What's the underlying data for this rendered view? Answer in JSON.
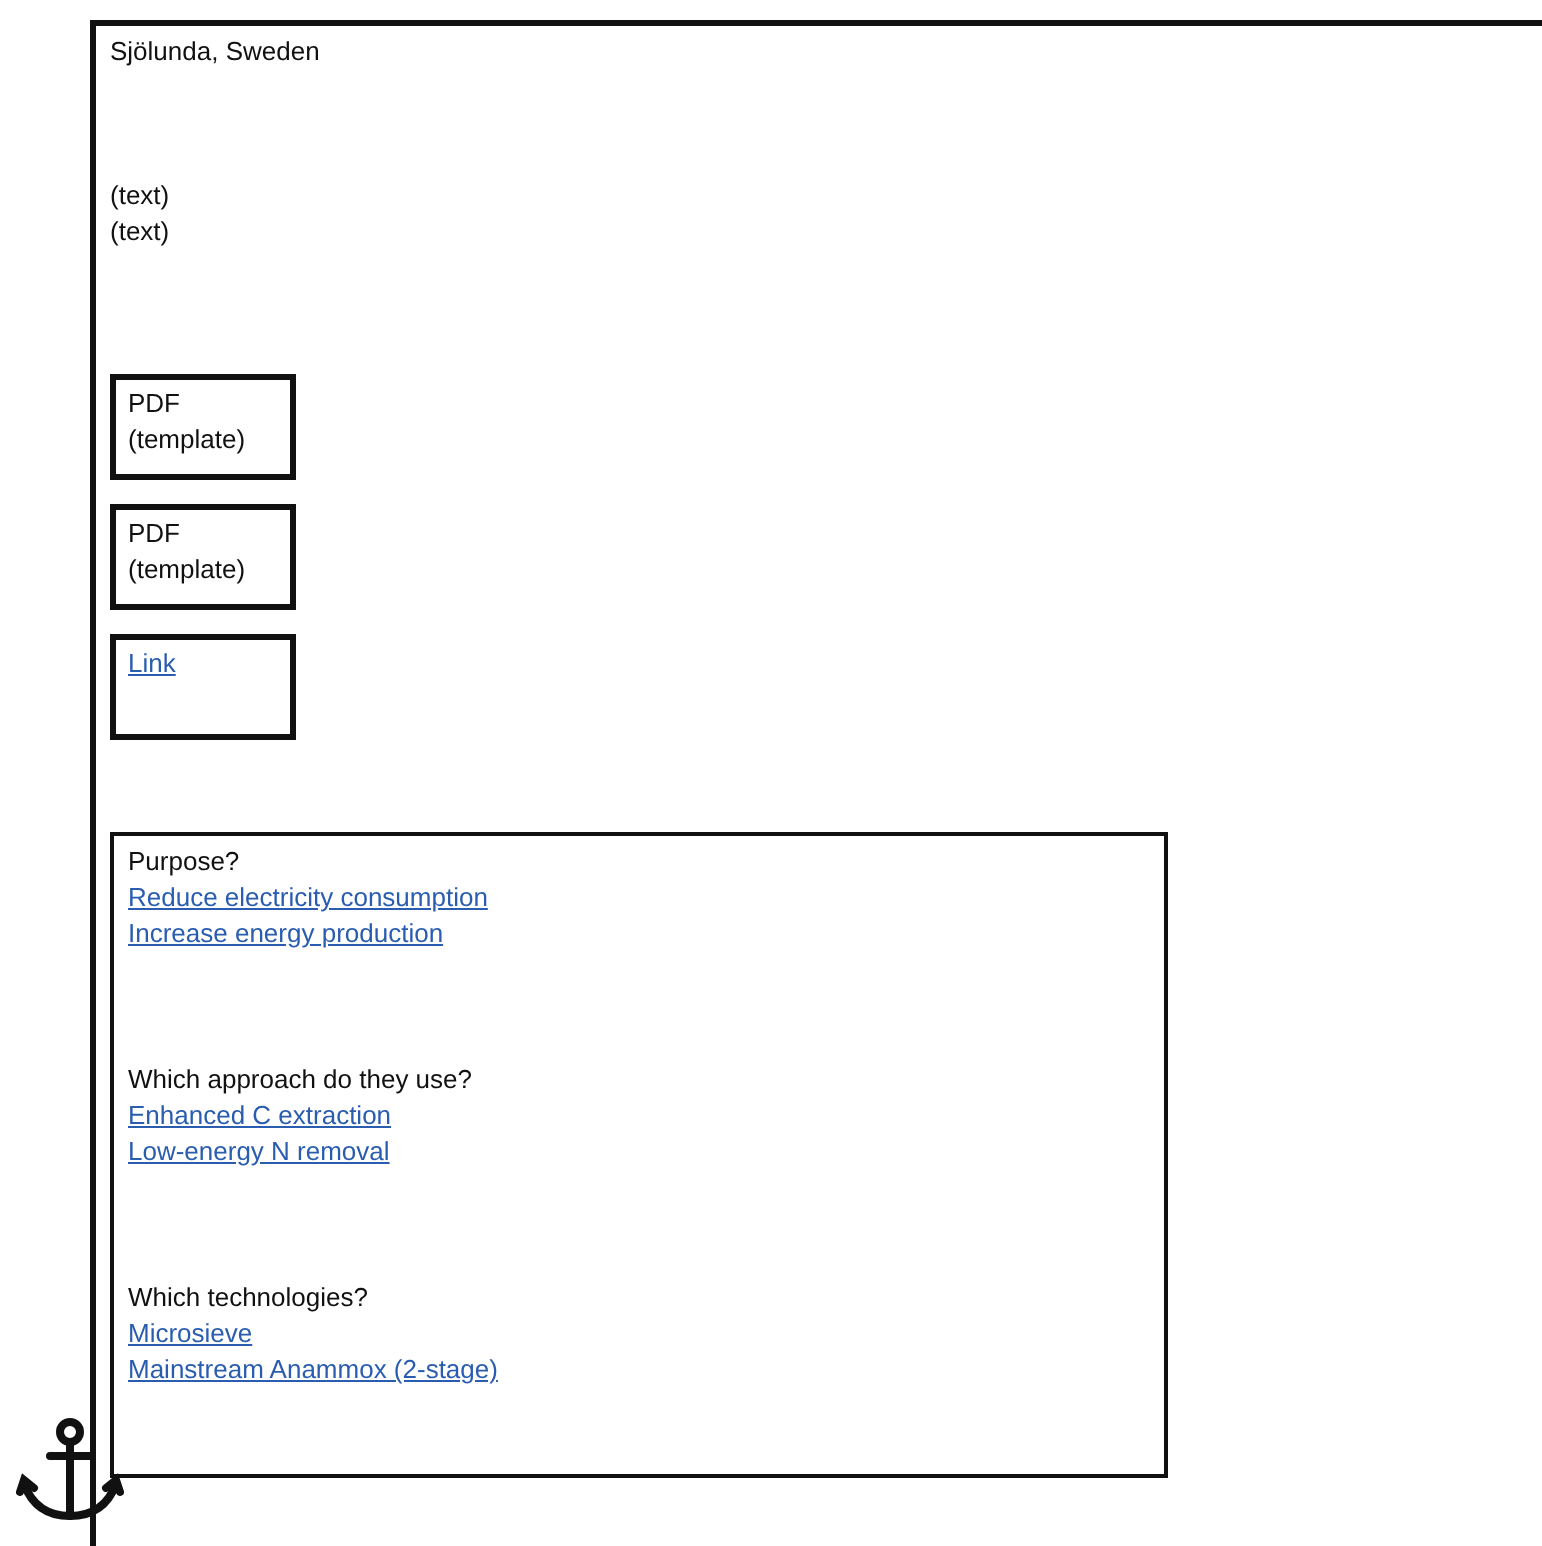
{
  "location": "Sjölunda, Sweden",
  "texts": [
    "(text)",
    "(text)"
  ],
  "cards": [
    {
      "kind": "document",
      "lines": [
        "PDF",
        "(template)"
      ]
    },
    {
      "kind": "document",
      "lines": [
        "PDF",
        "(template)"
      ]
    },
    {
      "kind": "link",
      "lines": [
        "Link"
      ]
    }
  ],
  "questions": [
    {
      "question": "Purpose?",
      "answers": [
        "Reduce electricity consumption",
        "Increase energy production"
      ]
    },
    {
      "question": "Which approach do they use?",
      "answers": [
        "Enhanced C extraction",
        "Low-energy N removal"
      ]
    },
    {
      "question": "Which technologies?",
      "answers": [
        "Microsieve",
        "Mainstream Anammox (2-stage)"
      ]
    }
  ]
}
